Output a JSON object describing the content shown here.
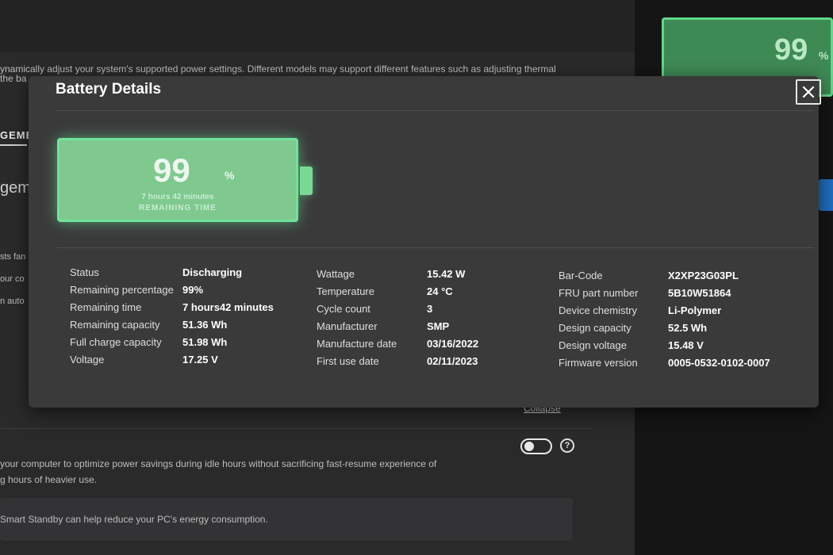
{
  "background": {
    "description_line1": "ynamically adjust your system's supported power settings. Different models may support different features such as adjusting thermal",
    "description_line2": "the ba",
    "tab_label": "GEME",
    "section_heading": "gem",
    "side_text1": "sts fan",
    "side_text2": "our co",
    "side_text3": "n auto",
    "collapse_link": "Collapse",
    "standby_desc_line1": "your computer to optimize power savings during idle hours without sacrificing fast-resume experience of",
    "standby_desc_line2": "g hours of heavier use.",
    "standby_info": "Smart Standby can help reduce your PC's energy consumption.",
    "help_symbol": "?",
    "mini_battery_percent": "99",
    "mini_battery_sign": "%",
    "toggle_state": "off"
  },
  "dialog": {
    "title": "Battery Details",
    "close_icon": "close-icon",
    "battery": {
      "percent": "99",
      "percent_sign": "%",
      "level": 0.99,
      "time_text": "7 hours 42 minutes",
      "remaining_label": "REMAINING TIME",
      "fill_color": "#7fc98f",
      "glow_color": "#72e29a"
    },
    "details": {
      "col1": [
        {
          "label": "Status",
          "value": "Discharging"
        },
        {
          "label": "Remaining percentage",
          "value": "99%"
        },
        {
          "label": "Remaining time",
          "value": "7 hours42 minutes"
        },
        {
          "label": "Remaining capacity",
          "value": "51.36 Wh"
        },
        {
          "label": "Full charge capacity",
          "value": "51.98 Wh"
        },
        {
          "label": "Voltage",
          "value": "17.25 V"
        }
      ],
      "col2": [
        {
          "label": "Wattage",
          "value": "15.42 W"
        },
        {
          "label": "Temperature",
          "value": "24 °C"
        },
        {
          "label": "Cycle count",
          "value": "3"
        },
        {
          "label": "Manufacturer",
          "value": "SMP"
        },
        {
          "label": "Manufacture date",
          "value": "03/16/2022"
        },
        {
          "label": "First use date",
          "value": "02/11/2023"
        }
      ],
      "col3": [
        {
          "label": "Bar-Code",
          "value": "X2XP23G03PL"
        },
        {
          "label": "FRU part number",
          "value": "5B10W51864"
        },
        {
          "label": "Device chemistry",
          "value": "Li-Polymer"
        },
        {
          "label": "Design capacity",
          "value": "52.5 Wh"
        },
        {
          "label": "Design voltage",
          "value": "15.48 V"
        },
        {
          "label": "Firmware version",
          "value": "0005-0532-0102-0007"
        }
      ]
    }
  }
}
